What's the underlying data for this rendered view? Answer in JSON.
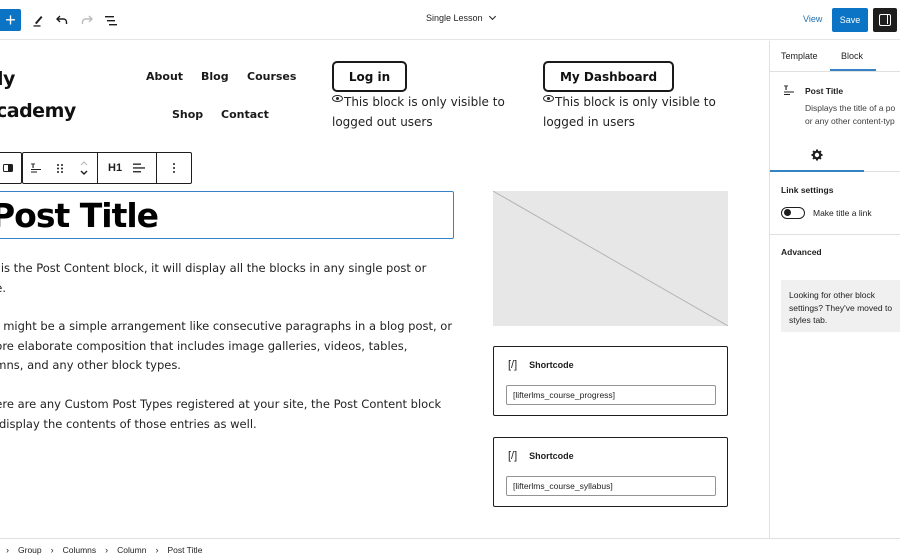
{
  "topbar": {
    "add_label": "+",
    "icons": [
      "add-block-icon",
      "tools-pencil-icon",
      "undo-icon",
      "redo-icon",
      "list-view-icon"
    ],
    "document_title": "Single Lesson",
    "view_label": "View",
    "save_label": "Save"
  },
  "header": {
    "site_title_line1": "ly",
    "site_title_line2": "cademy",
    "nav": [
      "About",
      "Blog",
      "Courses",
      "Shop",
      "Contact"
    ],
    "login_button": "Log in",
    "login_note": "This block is only visible to logged out users",
    "dashboard_button": "My  Dashboard",
    "dashboard_note": "This block is only visible to logged in users"
  },
  "block_toolbar": {
    "heading_level": "H1",
    "icons": [
      "parent-block-icon",
      "post-title-icon",
      "drag-handle-icon",
      "move-up-down-icon",
      "align-icon",
      "more-options-icon"
    ]
  },
  "content": {
    "post_title": "Post Title",
    "paragraphs": [
      "This is the Post Content block, it will display all the blocks in any single post or page.",
      "That might be a simple arrangement like consecutive paragraphs in a blog post, or a more elaborate composition that includes image galleries, videos, tables, columns, and any other block types.",
      "If there are any Custom Post Types registered at your site, the Post Content block can display the contents of those entries as well."
    ],
    "para_lines": [
      [
        "is is the Post Content block, it will display all the blocks in any single post or",
        "ge."
      ],
      [
        "at might be a simple arrangement like consecutive paragraphs in a blog post, or",
        "nore elaborate composition that includes image galleries, videos, tables,",
        "umns, and any other block types."
      ],
      [
        "here are any Custom Post Types registered at your site, the Post Content block",
        "n display the contents of those entries as well."
      ]
    ]
  },
  "shortcodes": [
    {
      "icon": "[/]",
      "label": "Shortcode",
      "value": "[lifterlms_course_progress]"
    },
    {
      "icon": "[/]",
      "label": "Shortcode",
      "value": "[lifterlms_course_syllabus]"
    }
  ],
  "sidebar": {
    "tabs": [
      "Template",
      "Block"
    ],
    "active_tab": "Block",
    "block_name": "Post Title",
    "block_desc_line1": "Displays the title of a po",
    "block_desc_line2": "or any other content-typ",
    "link_settings_title": "Link settings",
    "toggle_label": "Make title a link",
    "toggle_on": false,
    "advanced_title": "Advanced",
    "notice_lines": [
      "Looking for other block",
      "settings? They've moved to",
      "styles tab."
    ]
  },
  "breadcrumb": [
    "Group",
    "Columns",
    "Column",
    "Post Title"
  ],
  "colors": {
    "accent": "#0b74c4",
    "focus_border": "#3582c4",
    "link": "#2271b1",
    "dark": "#1e1e1e",
    "placeholder_bg": "#e7e7e7"
  }
}
